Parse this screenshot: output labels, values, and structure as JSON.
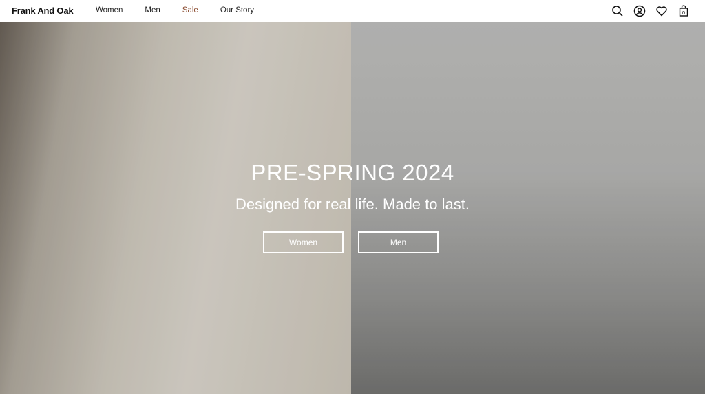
{
  "brand": "Frank And Oak",
  "nav": {
    "items": [
      {
        "label": "Women"
      },
      {
        "label": "Men"
      },
      {
        "label": "Sale"
      },
      {
        "label": "Our Story"
      }
    ]
  },
  "header_icons": {
    "search": "search-icon",
    "account": "account-icon",
    "wishlist": "heart-icon",
    "cart": "cart-icon",
    "cart_count": "0"
  },
  "hero": {
    "title": "PRE-SPRING 2024",
    "subtitle": "Designed for real life. Made to last.",
    "buttons": [
      {
        "label": "Women"
      },
      {
        "label": "Men"
      }
    ]
  },
  "colors": {
    "sale": "#8a4b2f",
    "hero_text": "#ffffff"
  }
}
